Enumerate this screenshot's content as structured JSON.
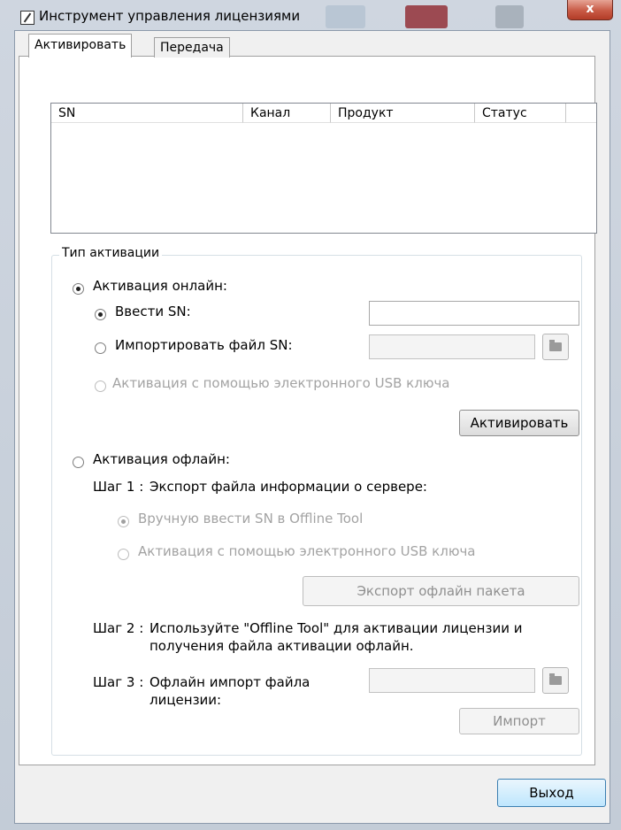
{
  "window": {
    "title": "Инструмент управления лицензиями",
    "close_label": "x"
  },
  "tabs": [
    {
      "label": "Активировать",
      "active": true
    },
    {
      "label": "Передача",
      "active": false
    }
  ],
  "table": {
    "columns": [
      "SN",
      "Канал",
      "Продукт",
      "Статус"
    ],
    "rows": []
  },
  "activation_type": {
    "legend": "Тип активации",
    "online": {
      "label": "Активация онлайн:",
      "enter_sn_label": "Ввести SN:",
      "import_sn_label": "Импортировать файл SN:",
      "usb_key_label": "Активация с помощью электронного USB ключа",
      "activate_button": "Активировать"
    },
    "offline": {
      "label": "Активация офлайн:",
      "step1_prefix": "Шаг 1 :",
      "step1_text": "Экспорт файла информации о сервере:",
      "manual_sn_label": "Вручную ввести SN в Offline Tool",
      "usb_key_label": "Активация с помощью электронного USB ключа",
      "export_button": "Экспорт офлайн пакета",
      "step2_prefix": "Шаг 2 :",
      "step2_line1": "Используйте \"Offline Tool\" для активации лицензии и",
      "step2_line2": "получения файла активации офлайн.",
      "step3_prefix": "Шаг 3 :",
      "step3_line1": "Офлайн импорт файла",
      "step3_line2": "лицензии:",
      "import_button": "Импорт"
    }
  },
  "footer": {
    "exit_button": "Выход"
  },
  "icons": {
    "app": "license-tool-icon",
    "browse": "folder-icon"
  },
  "colors": {
    "frame": "#c3ccd7",
    "close_button": "#c85a45",
    "focused_button": "#bee6fd"
  }
}
